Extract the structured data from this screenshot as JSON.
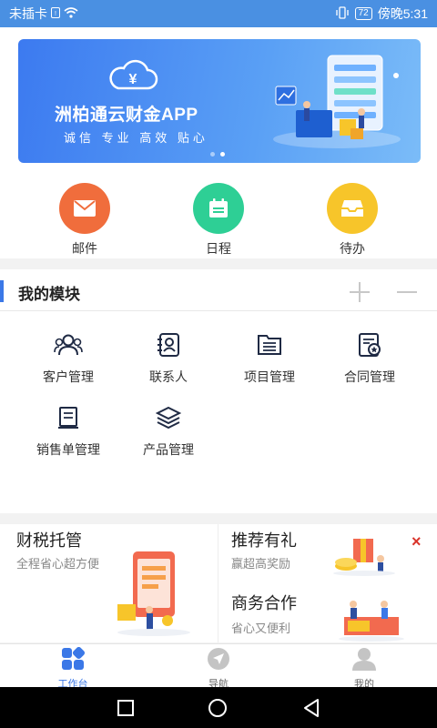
{
  "status_bar": {
    "carrier": "未插卡",
    "battery": "72",
    "time": "傍晚5:31"
  },
  "banner": {
    "title": "洲柏通云财金APP",
    "subtitle": "诚信 专业 高效 贴心",
    "page_count": 2,
    "active_page": 2
  },
  "quick_actions": [
    {
      "label": "邮件",
      "icon": "mail-icon",
      "color": "#f06d3c"
    },
    {
      "label": "日程",
      "icon": "calendar-icon",
      "color": "#2ecf95"
    },
    {
      "label": "待办",
      "icon": "inbox-icon",
      "color": "#f7c52a"
    }
  ],
  "modules": {
    "title": "我的模块",
    "items": [
      {
        "label": "客户管理",
        "icon": "customers-icon"
      },
      {
        "label": "联系人",
        "icon": "contacts-icon"
      },
      {
        "label": "项目管理",
        "icon": "project-icon"
      },
      {
        "label": "合同管理",
        "icon": "contract-icon"
      },
      {
        "label": "销售单管理",
        "icon": "sales-order-icon"
      },
      {
        "label": "产品管理",
        "icon": "product-icon"
      }
    ]
  },
  "promo": {
    "tax": {
      "title": "财税托管",
      "subtitle": "全程省心超方便"
    },
    "referral": {
      "title": "推荐有礼",
      "subtitle": "赢超高奖励"
    },
    "business": {
      "title": "商务合作",
      "subtitle": "省心又便利"
    },
    "close": "×"
  },
  "tabbar": [
    {
      "label": "工作台",
      "icon": "workbench-icon",
      "active": true
    },
    {
      "label": "导航",
      "icon": "navigation-icon",
      "active": false
    },
    {
      "label": "我的",
      "icon": "profile-icon",
      "active": false
    }
  ],
  "colors": {
    "accent": "#3b78e7",
    "tab_active": "#3b78e7",
    "tab_inactive": "#999999"
  }
}
